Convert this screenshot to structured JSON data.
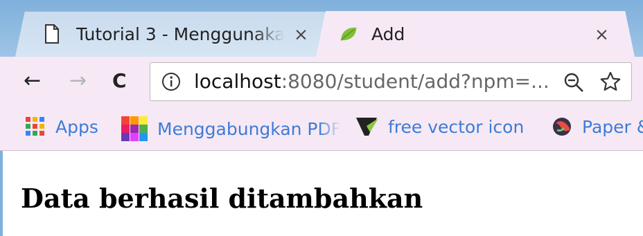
{
  "tabs": [
    {
      "title": "Tutorial 3 - Menggunaka",
      "close": "×",
      "icon": "document-icon",
      "active": false
    },
    {
      "title": "Add",
      "close": "×",
      "icon": "spring-leaf-icon",
      "active": true
    }
  ],
  "toolbar": {
    "back": "←",
    "forward": "→",
    "reload": "C",
    "url_host": "localhost",
    "url_rest": ":8080/student/add?npm=..."
  },
  "bookmarks": [
    {
      "label": "Apps",
      "icon": "apps-grid-icon"
    },
    {
      "label": "Menggabungkan PDF",
      "icon": "color-blocks-icon"
    },
    {
      "label": "free vector icon",
      "icon": "flaticon-icon"
    },
    {
      "label": "Paper &",
      "icon": "paper-globe-icon"
    }
  ],
  "page": {
    "heading": "Data berhasil ditambahkan"
  },
  "colors": {
    "tabstrip": "#9fc4e6",
    "chrome": "#f6e9f5",
    "bookmark_text": "#3d7bd8"
  }
}
